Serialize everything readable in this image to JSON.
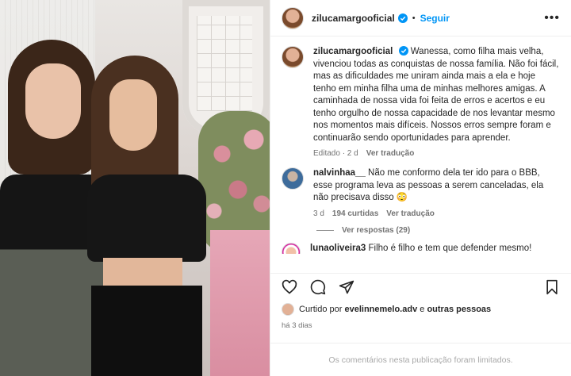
{
  "header": {
    "username": "zilucamargooficial",
    "separator": "•",
    "follow_label": "Seguir",
    "more_icon": "•••"
  },
  "caption": {
    "username": "zilucamargooficial",
    "text": "Wanessa, como filha mais velha, vivenciou todas as conquistas de nossa família. Não foi fácil, mas as dificuldades me uniram ainda mais a ela e hoje tenho em minha filha uma de minhas melhores amigas. A caminhada de nossa vida foi feita de erros e acertos e eu tenho orgulho de nossa capacidade de nos levantar mesmo nos momentos mais difíceis. Nossos erros sempre foram e continuarão sendo oportunidades para aprender.",
    "edited": "Editado · 2 d",
    "translate": "Ver tradução"
  },
  "comments": [
    {
      "username": "nalvinhaa__",
      "text": "Não me conformo dela ter ido para o BBB, esse programa leva as pessoas a serem canceladas, ela não precisava disso 😳",
      "age": "3 d",
      "likes": "194 curtidas",
      "translate": "Ver tradução",
      "replies": "Ver respostas (29)"
    },
    {
      "username": "lunaoliveira3",
      "text": "Filho é filho e tem que defender mesmo!"
    }
  ],
  "liked_by": {
    "prefix": "Curtido por",
    "user": "evelinnemelo.adv",
    "connector": "e",
    "others": "outras pessoas"
  },
  "date": "há 3 dias",
  "limited_notice": "Os comentários nesta publicação foram limitados.",
  "colors": {
    "follow": "#0095f6",
    "muted": "#737373"
  },
  "icons": [
    "heart-icon",
    "comment-icon",
    "share-icon",
    "bookmark-icon",
    "verified-icon"
  ]
}
